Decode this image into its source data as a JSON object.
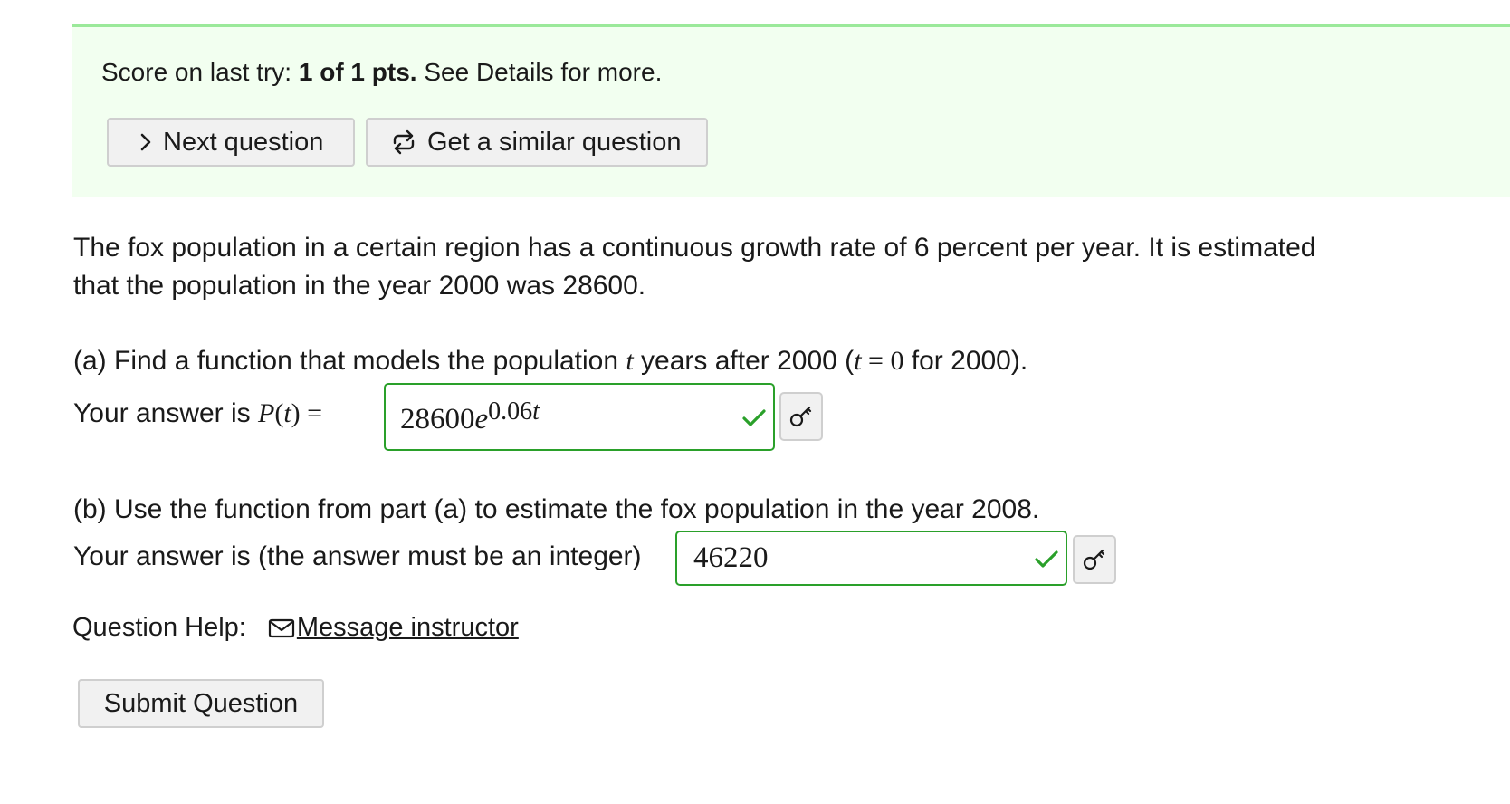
{
  "score": {
    "prefix": "Score on last try: ",
    "value": "1 of 1 pts.",
    "suffix": " See Details for more."
  },
  "buttons": {
    "next_question": "Next question",
    "similar_question": "Get a similar question",
    "submit_question": "Submit Question"
  },
  "problem": {
    "text": "The fox population in a certain region has a continuous growth rate of 6 percent per year. It is estimated that the population in the year 2000 was 28600."
  },
  "part_a": {
    "prompt_before": "(a) Find a function that models the population ",
    "prompt_var": "t",
    "prompt_mid": " years after 2000 (",
    "prompt_eq_var": "t",
    "prompt_eq": " = 0",
    "prompt_after": " for 2000).",
    "answer_label": "Your answer is ",
    "function_name": "P",
    "function_open": "(",
    "function_var": "t",
    "function_close": ")",
    "equals": " = ",
    "answer_base": "28600",
    "answer_e": "e",
    "answer_exp": "0.06",
    "answer_exp_var": "t",
    "status": "correct"
  },
  "part_b": {
    "prompt": "(b) Use the function from part (a) to estimate the fox population in the year 2008.",
    "answer_label": "Your answer is (the answer must be an integer)",
    "answer_value": "46220",
    "status": "correct"
  },
  "help": {
    "label": "Question Help:",
    "message_link": "Message instructor"
  },
  "colors": {
    "banner_bg": "#f2fff0",
    "banner_border": "#9be99a",
    "correct": "#2aa02a"
  },
  "icons": [
    "chevron-right-icon",
    "repeat-icon",
    "checkmark-icon",
    "key-icon",
    "envelope-icon"
  ]
}
